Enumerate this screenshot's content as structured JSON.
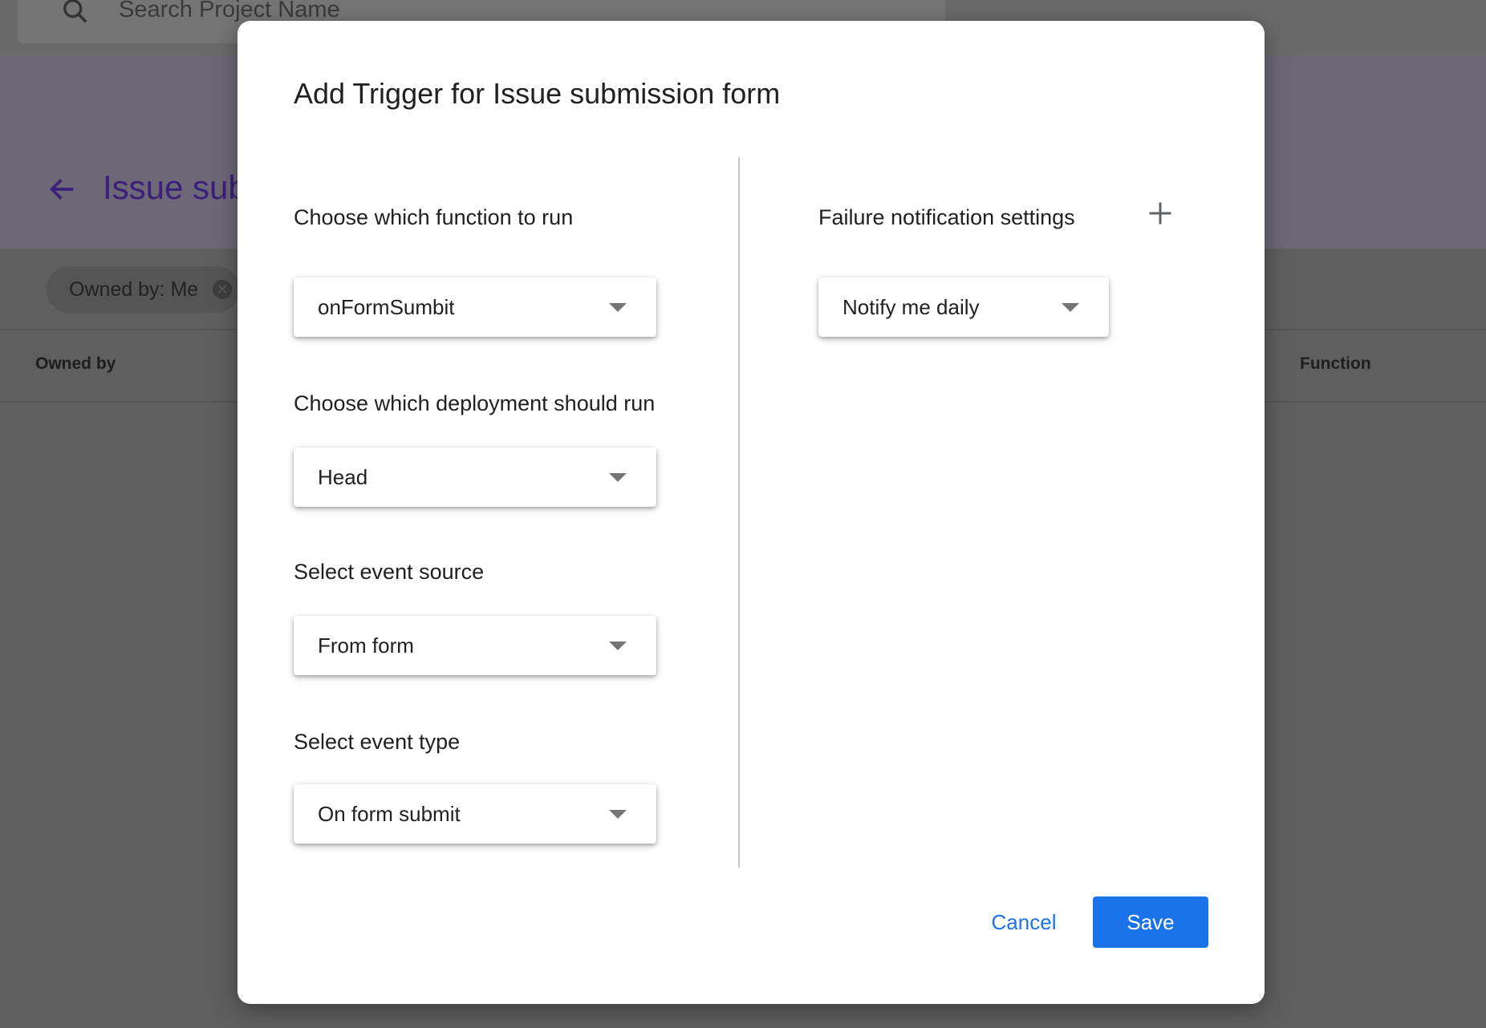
{
  "background": {
    "search_placeholder": "Search Project Name",
    "project_title": "Issue sub",
    "filter_chip": "Owned by: Me",
    "columns": {
      "owned_by": "Owned by",
      "function": "Function"
    }
  },
  "dialog": {
    "title": "Add Trigger for Issue submission form",
    "function_label": "Choose which function to run",
    "function_value": "onFormSumbit",
    "deployment_label": "Choose which deployment should run",
    "deployment_value": "Head",
    "event_source_label": "Select event source",
    "event_source_value": "From form",
    "event_type_label": "Select event type",
    "event_type_value": "On form submit",
    "failure_label": "Failure notification settings",
    "failure_value": "Notify me daily",
    "cancel_label": "Cancel",
    "save_label": "Save"
  },
  "colors": {
    "primary": "#1a73e8",
    "backdrop": "#5f5f5f",
    "title_purple": "#3c1f78"
  }
}
